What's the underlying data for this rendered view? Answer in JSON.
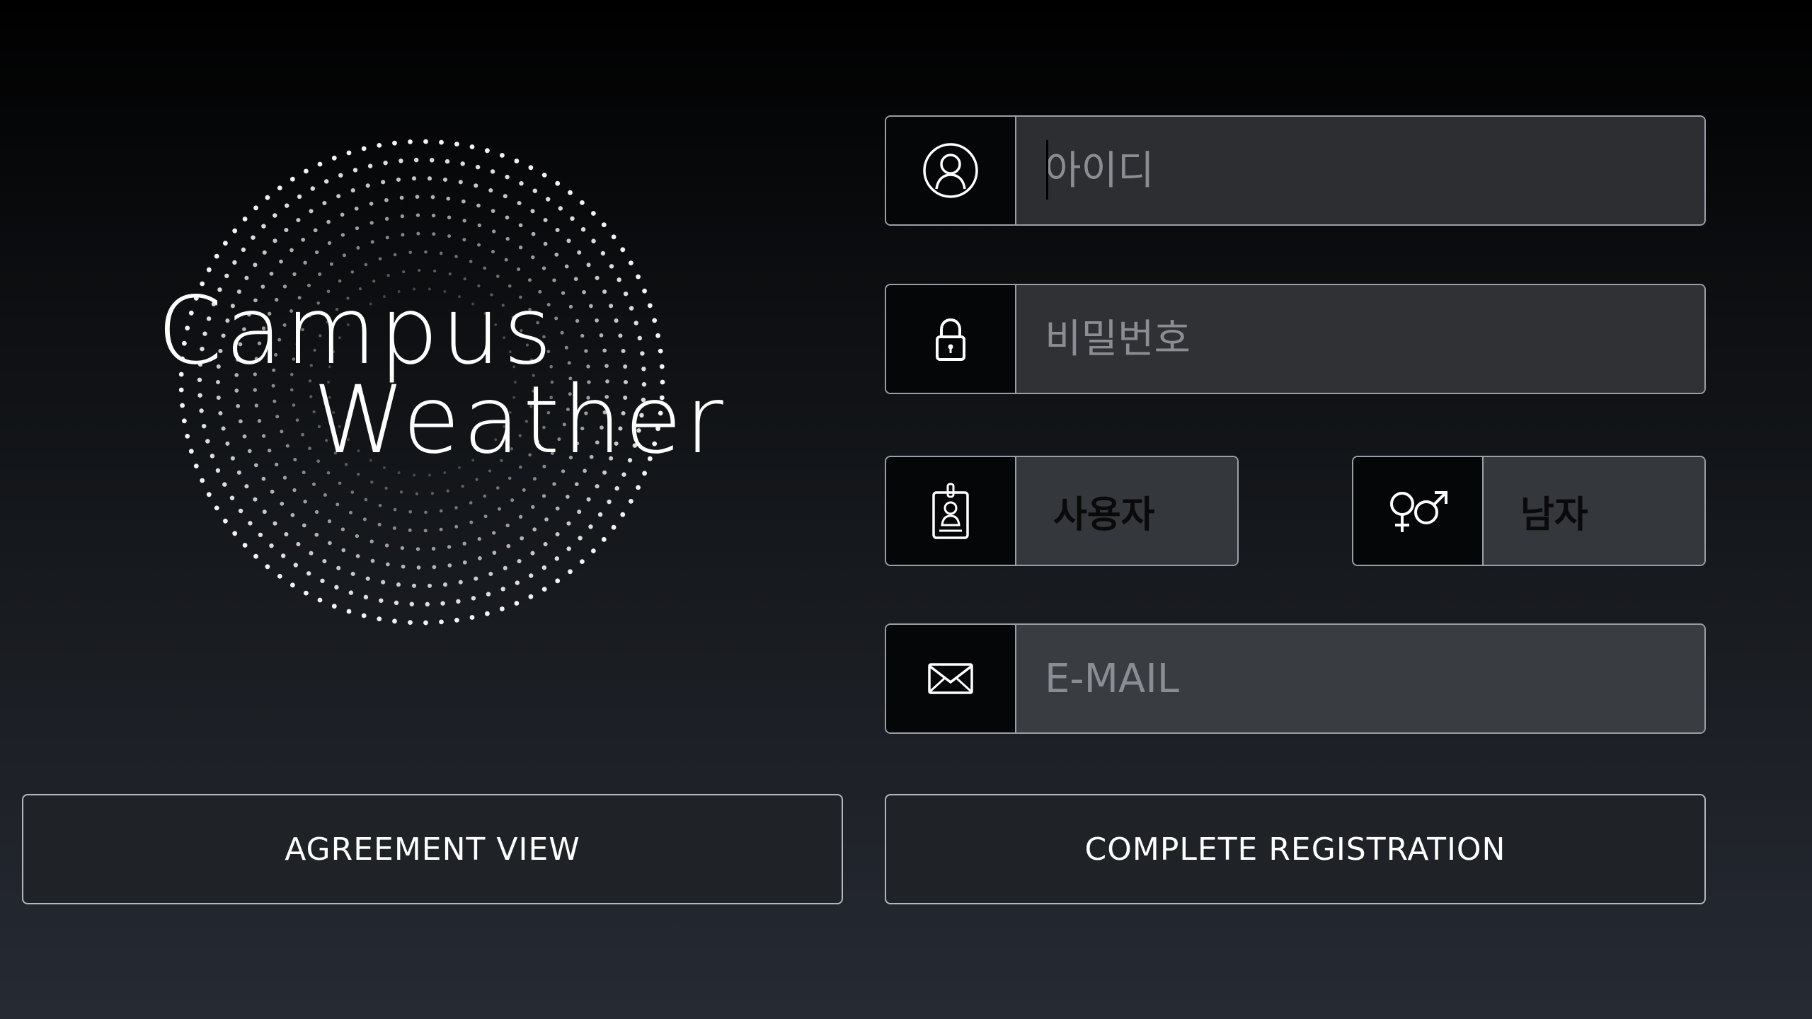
{
  "logo": {
    "line1": "Campus",
    "line2": "Weather"
  },
  "form": {
    "id_field": {
      "icon": "user-icon",
      "placeholder": "아이디",
      "value": ""
    },
    "password_field": {
      "icon": "lock-icon",
      "placeholder": "비밀번호",
      "value": ""
    },
    "role_select": {
      "icon": "id-badge-icon",
      "value": "사용자"
    },
    "gender_select": {
      "icon": "gender-icon",
      "value": "남자"
    },
    "email_field": {
      "icon": "mail-icon",
      "placeholder": "E-MAIL",
      "value": ""
    }
  },
  "buttons": {
    "agreement_label": "AGREEMENT VIEW",
    "complete_label": "COMPLETE REGISTRATION"
  },
  "colors": {
    "background_top": "#000000",
    "background_bottom": "#262a33",
    "border": "#9a9ea6",
    "icon_cell": "#050607"
  }
}
